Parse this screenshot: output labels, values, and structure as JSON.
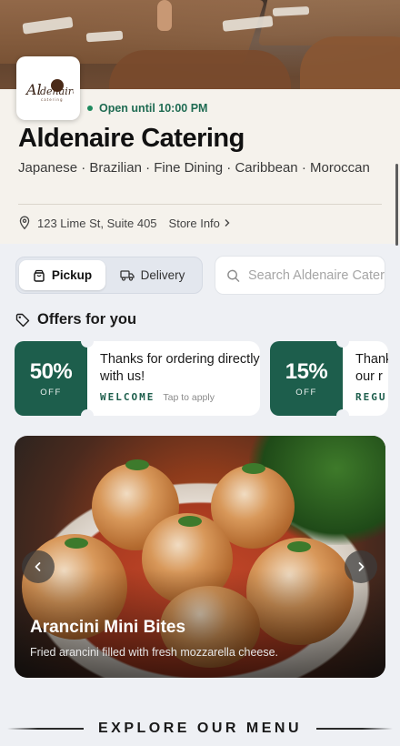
{
  "restaurant": {
    "logo_text": "Aldenaire Catering",
    "status": "Open until 10:00 PM",
    "name": "Aldenaire Catering",
    "cuisines": "Japanese · Brazilian · Fine Dining · Caribbean · Moroccan",
    "address": "123 Lime St, Suite 405",
    "store_info_label": "Store Info"
  },
  "order_mode": {
    "options": [
      {
        "label": "Pickup",
        "icon": "bag-icon",
        "selected": true
      },
      {
        "label": "Delivery",
        "icon": "truck-icon",
        "selected": false
      }
    ]
  },
  "search": {
    "placeholder": "Search Aldenaire Catering"
  },
  "offers": {
    "heading": "Offers for you",
    "items": [
      {
        "percent": "50%",
        "off": "OFF",
        "message": "Thanks for ordering directly with us!",
        "code": "WELCOME",
        "hint": "Tap to apply"
      },
      {
        "percent": "15%",
        "off": "OFF",
        "message": "Thanks for ordering with our r",
        "code": "REGU",
        "hint": ""
      }
    ]
  },
  "featured": {
    "title": "Arancini Mini Bites",
    "description": "Fried arancini filled with fresh mozzarella cheese."
  },
  "explore": {
    "label": "EXPLORE OUR MENU"
  },
  "colors": {
    "accent_green": "#1d5e4c",
    "status_green": "#1f8a5e",
    "page_bg": "#eef0f4"
  }
}
